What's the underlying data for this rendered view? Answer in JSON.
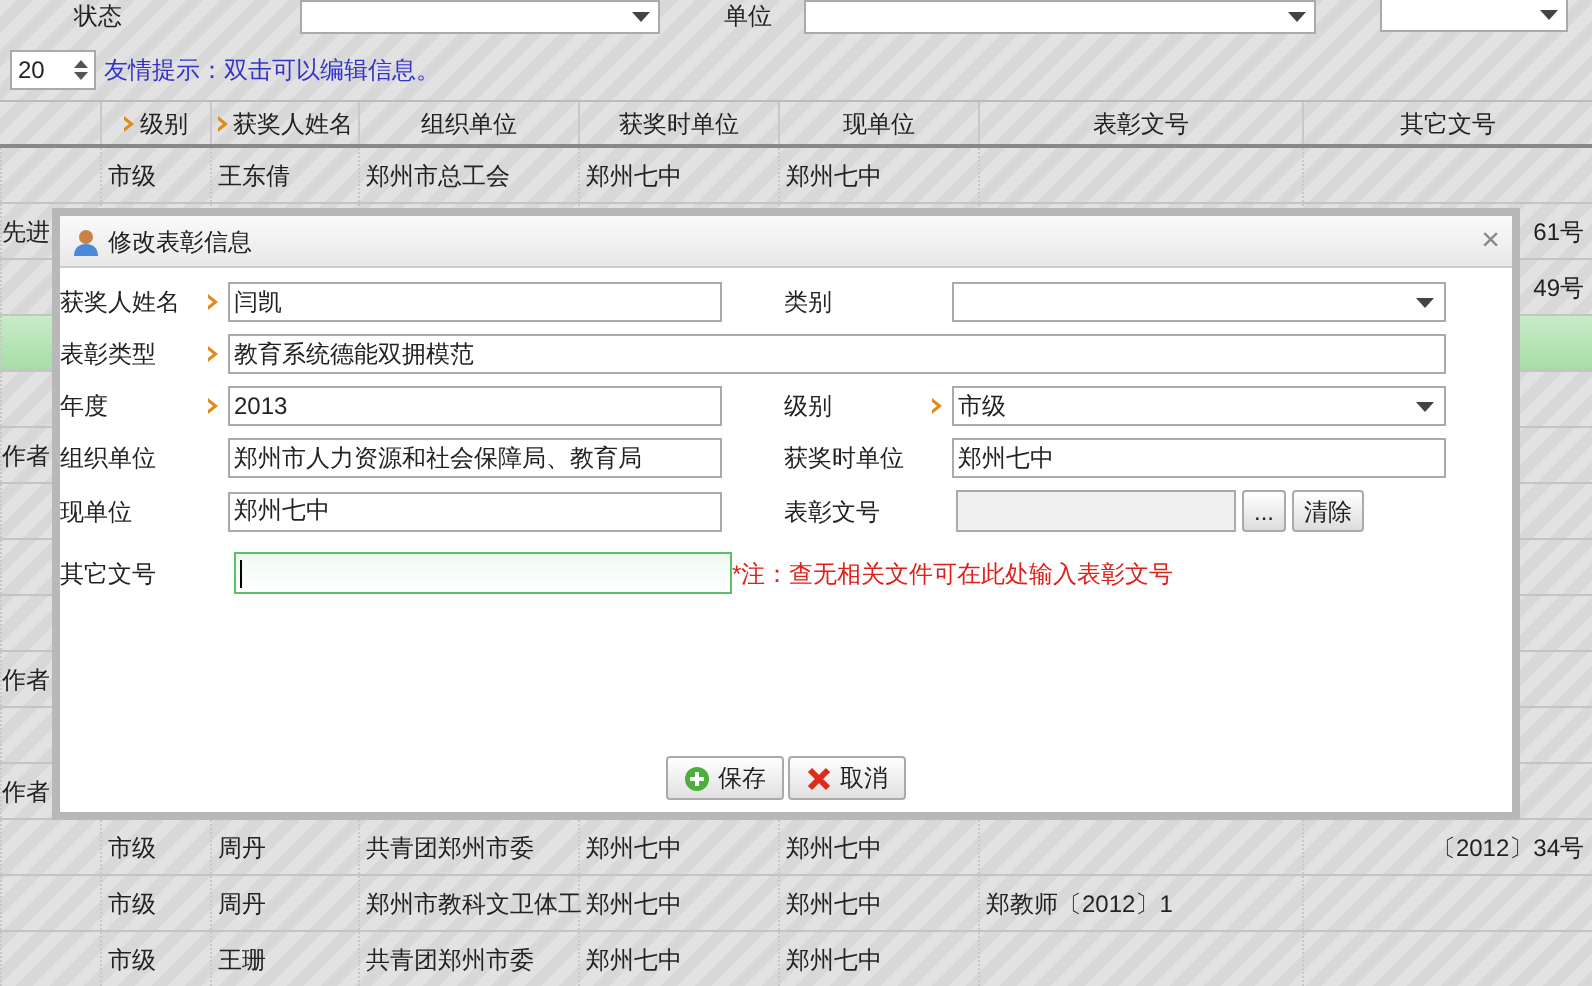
{
  "filters": [
    {
      "kind": "select",
      "label": "状态"
    },
    {
      "kind": "select",
      "label": "单位"
    },
    {
      "kind": "select"
    }
  ],
  "pager": {
    "page_size": "20",
    "hint": "友情提示：双击可以编辑信息。"
  },
  "table": {
    "columns": [
      {
        "label": "级别",
        "required": true
      },
      {
        "label": "获奖人姓名",
        "required": true
      },
      {
        "label": "组织单位",
        "required": false
      },
      {
        "label": "获奖时单位",
        "required": false
      },
      {
        "label": "现单位",
        "required": false
      },
      {
        "label": "表彰文号",
        "required": false
      },
      {
        "label": "其它文号",
        "required": false
      }
    ],
    "rows": [
      {
        "selected": false,
        "level": "市级",
        "name": "王东倩",
        "org": "郑州市总工会",
        "unit_at_award": "郑州七中",
        "current_unit": "郑州七中"
      },
      {
        "selected": false,
        "column_1": "先进",
        "other_no": "61号"
      },
      {
        "selected": false,
        "other_no": "49号"
      },
      {
        "selected": true
      },
      {
        "selected": false
      },
      {
        "selected": false,
        "column_1": "作者"
      },
      {
        "selected": false
      },
      {
        "selected": false
      },
      {
        "selected": false
      },
      {
        "selected": false,
        "column_1": "作者"
      },
      {
        "selected": false
      },
      {
        "selected": false,
        "column_1": "作者"
      },
      {
        "selected": false,
        "level": "市级",
        "name": "周丹",
        "org": "共青团郑州市委",
        "unit_at_award": "郑州七中",
        "current_unit": "郑州七中",
        "other_no": "〔2012〕34号"
      },
      {
        "selected": false,
        "level": "市级",
        "name": "周丹",
        "org": "郑州市教科文卫体工",
        "unit_at_award": "郑州七中",
        "current_unit": "郑州七中",
        "commendation_no": "郑教师〔2012〕1"
      },
      {
        "selected": false,
        "level": "市级",
        "name": "王珊",
        "org": "共青团郑州市委",
        "unit_at_award": "郑州七中",
        "current_unit": "郑州七中"
      }
    ]
  },
  "dialog": {
    "title": "修改表彰信息",
    "close": "×",
    "rows": [
      [
        {
          "label": "获奖人姓名",
          "required": true,
          "kind": "text",
          "value": "闫凯",
          "focused": false
        },
        {
          "label": "类别",
          "required": false,
          "kind": "select",
          "focused": false
        }
      ],
      [
        {
          "label": "表彰类型",
          "required": true,
          "kind": "wide",
          "value": "教育系统德能双拥模范",
          "focused": false
        }
      ],
      [
        {
          "label": "年度",
          "required": true,
          "kind": "text",
          "value": "2013",
          "focused": false
        },
        {
          "label": "级别",
          "required": true,
          "kind": "select",
          "value": "市级",
          "focused": false
        }
      ],
      [
        {
          "label": "组织单位",
          "required": false,
          "kind": "text",
          "value": "郑州市人力资源和社会保障局、教育局",
          "focused": false
        },
        {
          "label": "获奖时单位",
          "required": false,
          "kind": "text",
          "value": "郑州七中",
          "focused": false
        }
      ],
      [
        {
          "label": "现单位",
          "required": false,
          "kind": "text",
          "value": "郑州七中",
          "focused": false
        },
        {
          "label": "表彰文号",
          "required": false,
          "kind": "lookup",
          "focused": false,
          "buttons": [
            "...",
            "清除"
          ]
        }
      ],
      [
        {
          "label": "其它文号",
          "required": false,
          "kind": "note",
          "focused": true,
          "note": "*注：查无相关文件可在此处输入表彰文号"
        }
      ]
    ],
    "buttons": [
      {
        "label": "保存",
        "kind": "save"
      },
      {
        "label": "取消",
        "kind": "cancel"
      }
    ]
  }
}
